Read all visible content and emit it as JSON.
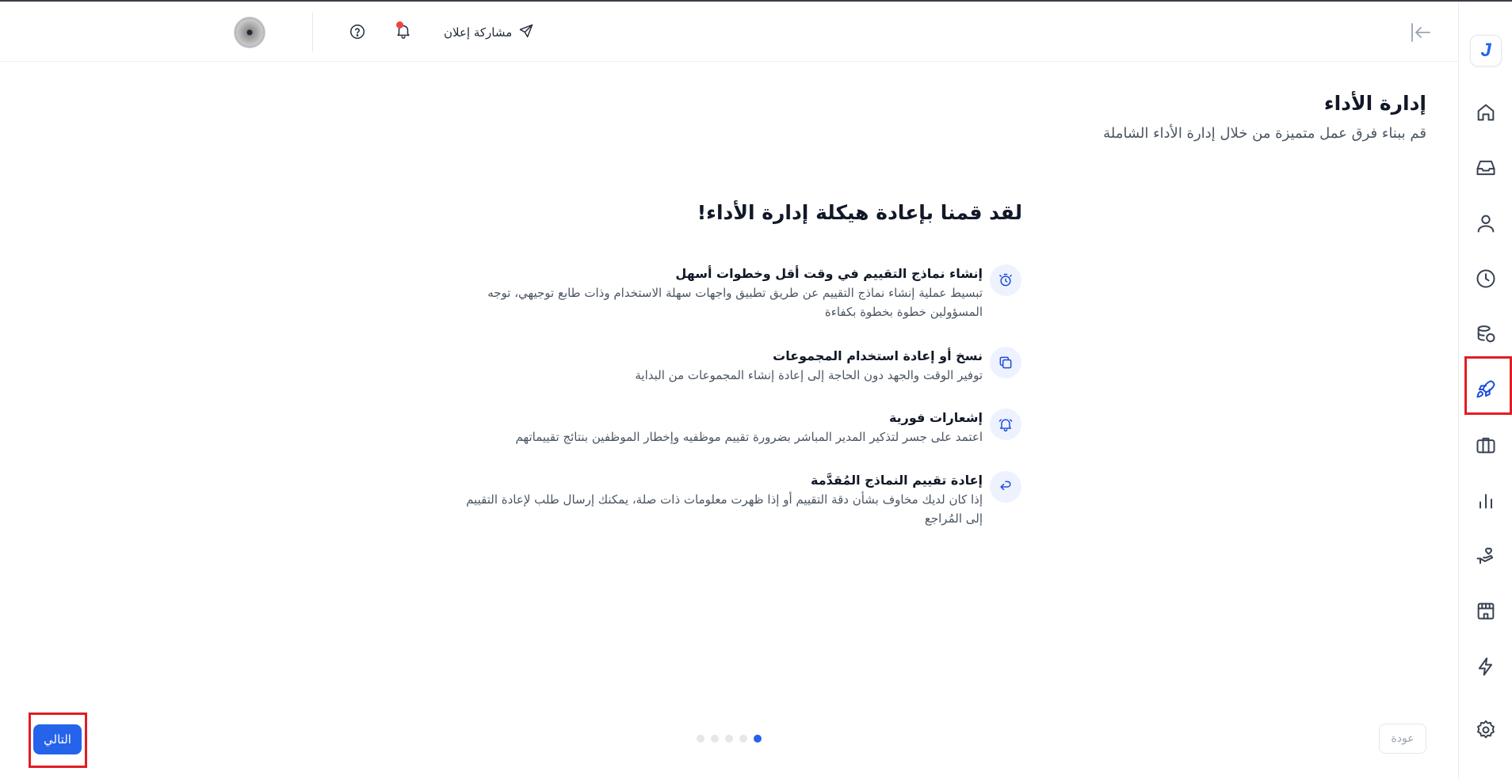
{
  "topbar": {
    "share_label": "مشاركة إعلان",
    "notification_dot_color": "#ef4444"
  },
  "sidebar": {
    "logo_letter": "J",
    "items": [
      {
        "name": "home"
      },
      {
        "name": "inbox"
      },
      {
        "name": "user"
      },
      {
        "name": "clock"
      },
      {
        "name": "coins"
      },
      {
        "name": "rocket",
        "active": true
      },
      {
        "name": "briefcase"
      },
      {
        "name": "chart"
      },
      {
        "name": "hand-heart"
      },
      {
        "name": "store"
      },
      {
        "name": "lightning"
      },
      {
        "name": "settings"
      }
    ]
  },
  "page": {
    "title": "إدارة الأداء",
    "subtitle": "قم ببناء فرق عمل متميزة من خلال إدارة الأداء الشاملة"
  },
  "intro": {
    "headline": "لقد قمنا بإعادة هيكلة إدارة الأداء!",
    "features": [
      {
        "icon": "timer-icon",
        "title": "إنشاء نماذج التقييم في وقت أقل وخطوات أسهل",
        "desc_line1": "تبسيط عملية إنشاء نماذج التقييم عن طريق تطبيق واجهات سهلة الاستخدام وذات طابع توجيهي، توجه",
        "desc_line2": "المسؤولين خطوة بخطوة بكفاءة"
      },
      {
        "icon": "copy-icon",
        "title": "نسخ أو إعادة استخدام المجموعات",
        "desc_line1": "توفير الوقت والجهد دون الحاجة إلى إعادة إنشاء المجموعات من البداية"
      },
      {
        "icon": "bell-ring-icon",
        "title": "إشعارات فورية",
        "desc_line1": "اعتمد على جسر لتذكير المدير المباشر بضرورة تقييم موظفيه وإخطار الموظفين بنتائج تقييماتهم"
      },
      {
        "icon": "undo-icon",
        "title": "إعادة تقييم النماذج المُقدَّمة",
        "desc_line1": "إذا كان لديك مخاوف بشأن دقة التقييم أو إذا ظهرت معلومات ذات صلة، يمكنك إرسال طلب لإعادة التقييم",
        "desc_line2": "إلى المُراجع"
      }
    ]
  },
  "footer": {
    "back_label": "عودة",
    "next_label": "التالي",
    "step_count": 5,
    "current_step": 5
  },
  "colors": {
    "accent": "#2563eb",
    "highlight_box": "#e11d22"
  }
}
